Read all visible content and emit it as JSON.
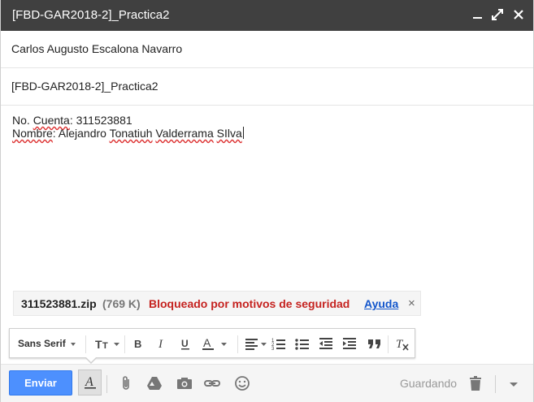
{
  "window": {
    "title": "[FBD-GAR2018-2]_Practica2"
  },
  "fields": {
    "to": "Carlos Augusto Escalona Navarro",
    "subject": "[FBD-GAR2018-2]_Practica2"
  },
  "message": {
    "line1": {
      "label": "No. ",
      "label_word": "Cuenta",
      "value": ": 311523881"
    },
    "line2": {
      "label_word": "Nombre",
      "sep": ": Alejandro ",
      "w1": "Tonatiuh",
      "sp1": " ",
      "w2": "Valderrama",
      "sp2": " ",
      "w3": "SIlva"
    }
  },
  "attachment": {
    "filename": "311523881.zip",
    "size": "(769 K)",
    "status": "Bloqueado por motivos de seguridad",
    "help": "Ayuda",
    "remove": "×"
  },
  "formatting": {
    "font": "Sans Serif"
  },
  "bottombar": {
    "send": "Enviar",
    "status": "Guardando"
  },
  "colors": {
    "titlebar": "#404040",
    "send": "#4d90fe",
    "blocked": "#c5221f",
    "link": "#1155cc"
  }
}
